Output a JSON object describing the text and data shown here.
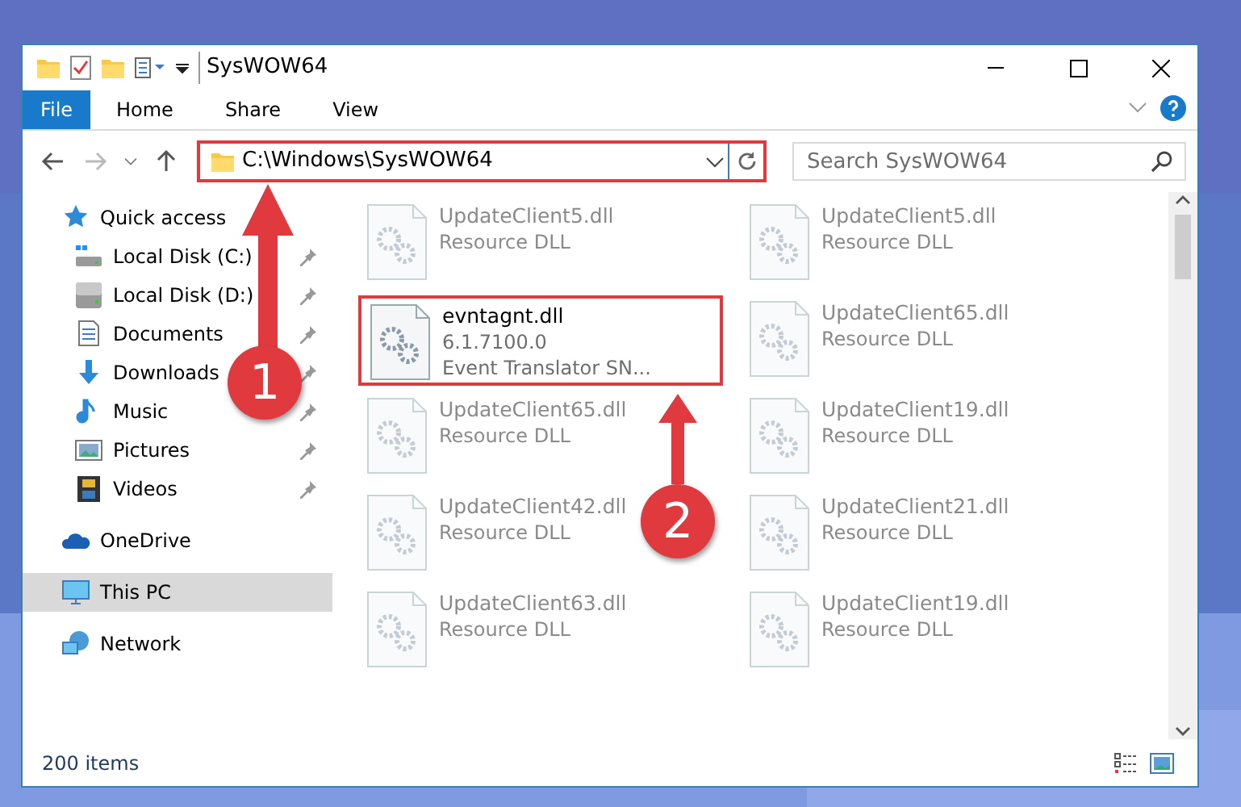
{
  "window": {
    "title": "SysWOW64"
  },
  "ribbon_tabs": [
    {
      "label": "File",
      "kind": "file",
      "selected": false
    },
    {
      "label": "Home",
      "kind": "tab",
      "selected": false
    },
    {
      "label": "Share",
      "kind": "tab",
      "selected": false
    },
    {
      "label": "View",
      "kind": "tab",
      "selected": false
    }
  ],
  "address_bar": {
    "value": "C:\\Windows\\SysWOW64",
    "highlighted": true
  },
  "search": {
    "placeholder": "Search SysWOW64"
  },
  "sidebar": {
    "items": [
      {
        "label": "Quick access",
        "kind": "star",
        "selected": false,
        "children": [
          {
            "label": "Local Disk (C:)",
            "kind": "windisk",
            "pinned": true,
            "selected": false
          },
          {
            "label": "Local Disk (D:)",
            "kind": "disk",
            "pinned": true,
            "selected": false
          },
          {
            "label": "Documents",
            "kind": "documents",
            "pinned": true,
            "selected": false
          },
          {
            "label": "Downloads",
            "kind": "downloads",
            "pinned": true,
            "selected": false
          },
          {
            "label": "Music",
            "kind": "music",
            "pinned": true,
            "selected": false
          },
          {
            "label": "Pictures",
            "kind": "pictures",
            "pinned": true,
            "selected": false
          },
          {
            "label": "Videos",
            "kind": "videos",
            "pinned": true,
            "selected": false
          }
        ]
      },
      {
        "label": "OneDrive",
        "kind": "cloud",
        "selected": false
      },
      {
        "label": "This PC",
        "kind": "pc",
        "selected": true
      },
      {
        "label": "Network",
        "kind": "network",
        "selected": false
      }
    ]
  },
  "files": [
    {
      "name": "UpdateClient5.dll",
      "details": [
        "Resource DLL"
      ],
      "blurred": true,
      "highlighted": false
    },
    {
      "name": "UpdateClient5.dll",
      "details": [
        "Resource DLL"
      ],
      "blurred": true,
      "highlighted": false
    },
    {
      "name": "evntagnt.dll",
      "details": [
        "6.1.7100.0",
        "Event Translator SN..."
      ],
      "blurred": false,
      "highlighted": true
    },
    {
      "name": "UpdateClient65.dll",
      "details": [
        "Resource DLL"
      ],
      "blurred": true,
      "highlighted": false
    },
    {
      "name": "UpdateClient65.dll",
      "details": [
        "Resource DLL"
      ],
      "blurred": true,
      "highlighted": false
    },
    {
      "name": "UpdateClient19.dll",
      "details": [
        "Resource DLL"
      ],
      "blurred": true,
      "highlighted": false
    },
    {
      "name": "UpdateClient42.dll",
      "details": [
        "Resource DLL"
      ],
      "blurred": true,
      "highlighted": false
    },
    {
      "name": "UpdateClient21.dll",
      "details": [
        "Resource DLL"
      ],
      "blurred": true,
      "highlighted": false
    },
    {
      "name": "UpdateClient63.dll",
      "details": [
        "Resource DLL"
      ],
      "blurred": true,
      "highlighted": false
    },
    {
      "name": "UpdateClient19.dll",
      "details": [
        "Resource DLL"
      ],
      "blurred": true,
      "highlighted": false
    }
  ],
  "status_bar": {
    "text": "200 items"
  },
  "annotations": [
    {
      "label": "1"
    },
    {
      "label": "2"
    }
  ]
}
